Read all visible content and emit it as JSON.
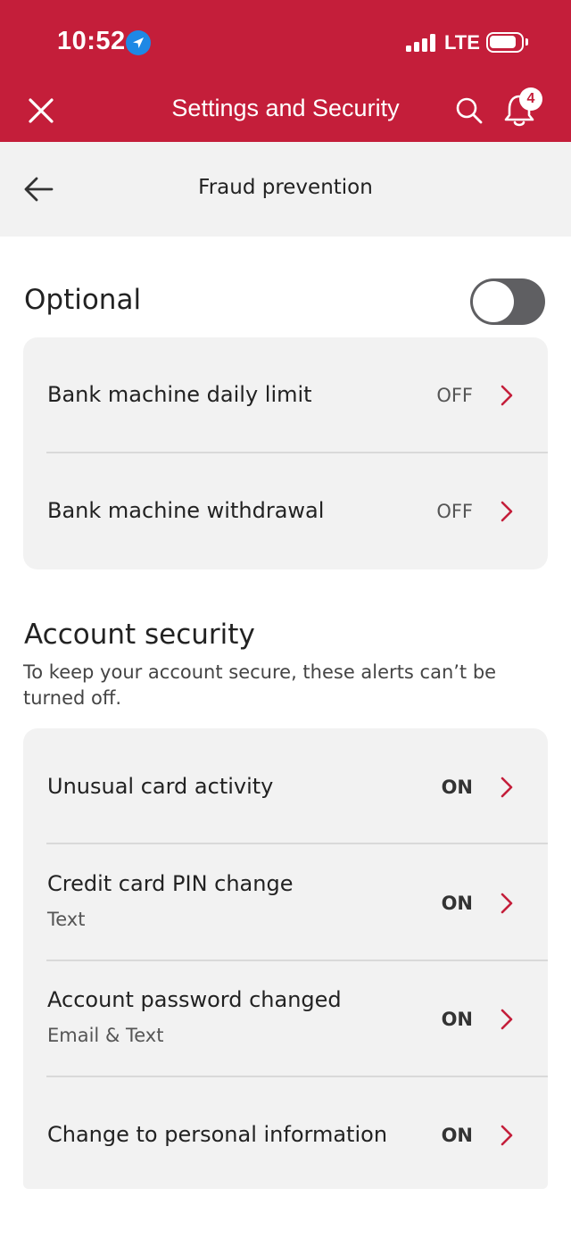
{
  "status_bar": {
    "time": "10:52",
    "network": "LTE",
    "location_icon": "location-arrow-icon",
    "signal_icon": "signal-bars-icon",
    "battery_icon": "battery-icon"
  },
  "header": {
    "title": "Settings and Security",
    "notification_count": "4",
    "close_icon": "close-icon",
    "search_icon": "search-icon",
    "bell_icon": "bell-icon",
    "brand_color": "#C41E3A"
  },
  "subheader": {
    "title": "Fraud prevention",
    "back_icon": "back-arrow-icon"
  },
  "optional": {
    "title": "Optional",
    "toggle_on": false,
    "items": [
      {
        "label": "Bank machine daily limit",
        "status": "OFF"
      },
      {
        "label": "Bank machine withdrawal",
        "status": "OFF"
      }
    ]
  },
  "account_security": {
    "title": "Account security",
    "description": "To keep your account secure, these alerts can’t be turned off.",
    "items": [
      {
        "label": "Unusual card activity",
        "sub": "",
        "status": "ON"
      },
      {
        "label": "Credit card PIN change",
        "sub": "Text",
        "status": "ON"
      },
      {
        "label": "Account password changed",
        "sub": "Email & Text",
        "status": "ON"
      },
      {
        "label": "Change to personal information",
        "sub": "",
        "status": "ON"
      }
    ]
  },
  "colors": {
    "chevron": "#C41E3A",
    "card_background": "#F2F2F2",
    "toggle_off": "#5f5f62"
  }
}
